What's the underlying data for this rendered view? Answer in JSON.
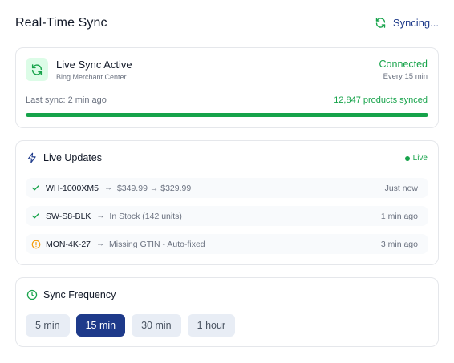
{
  "header": {
    "title": "Real-Time Sync",
    "status_label": "Syncing...",
    "status_icon": "refresh-icon"
  },
  "status_card": {
    "title": "Live Sync Active",
    "subtitle": "Bing Merchant Center",
    "connection_status": "Connected",
    "frequency": "Every 15 min",
    "last_sync": "Last sync: 2 min ago",
    "products_synced": "12,847 products synced",
    "progress_percent": 100,
    "accent_color": "#16a34a"
  },
  "live_updates": {
    "title": "Live Updates",
    "badge": "Live",
    "items": [
      {
        "status": "success",
        "icon": "check-icon",
        "sku": "WH-1000XM5",
        "change": "$349.99 → $329.99",
        "time": "Just now"
      },
      {
        "status": "success",
        "icon": "check-icon",
        "sku": "SW-S8-BLK",
        "change": "In Stock (142 units)",
        "time": "1 min ago"
      },
      {
        "status": "warning",
        "icon": "alert-circle-icon",
        "sku": "MON-4K-27",
        "change": "Missing GTIN - Auto-fixed",
        "time": "3 min ago"
      }
    ]
  },
  "sync_frequency": {
    "title": "Sync Frequency",
    "options": [
      "5 min",
      "15 min",
      "30 min",
      "1 hour"
    ],
    "selected": "15 min",
    "selected_color": "#1e3a8a"
  }
}
